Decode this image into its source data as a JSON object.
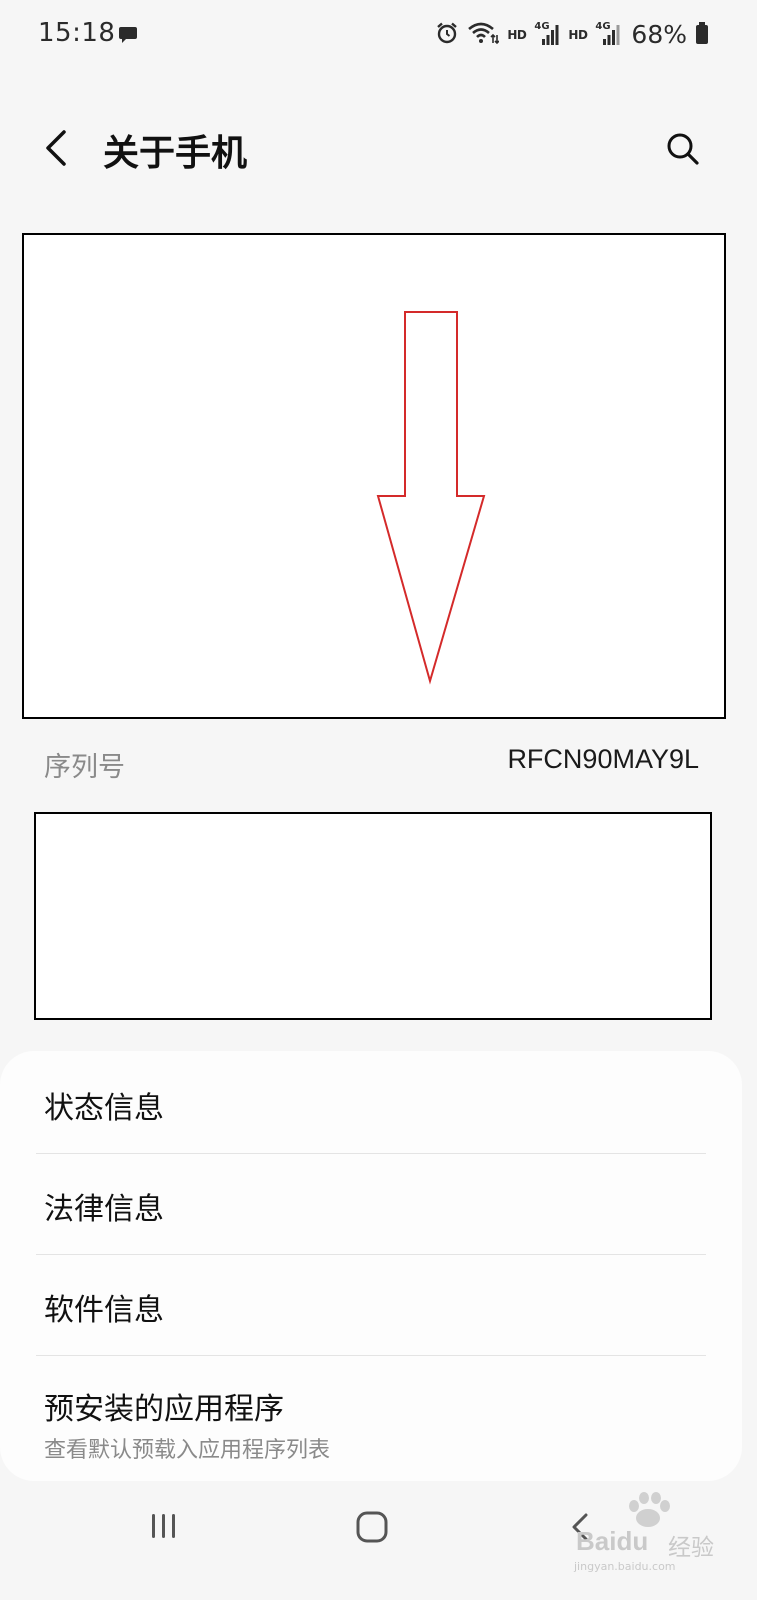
{
  "status_bar": {
    "time": "15:18",
    "hd_1": "HD",
    "net_1": "4G",
    "hd_2": "HD",
    "net_2": "4G",
    "battery": "68%"
  },
  "header": {
    "title": "关于手机"
  },
  "annotation": {
    "arrow_color": "#d42a2a",
    "arrow_direction": "down"
  },
  "device_info": {
    "serial_label": "序列号",
    "serial_value": "RFCN90MAY9L"
  },
  "menu": {
    "items": [
      {
        "label": "状态信息"
      },
      {
        "label": "法律信息"
      },
      {
        "label": "软件信息"
      },
      {
        "label": "预安装的应用程序",
        "sublabel": "查看默认预载入应用程序列表"
      }
    ]
  },
  "watermark": {
    "brand": "Bai",
    "brand_2": "du",
    "label_cn": "经验",
    "url": "jingyan.baidu.com"
  }
}
